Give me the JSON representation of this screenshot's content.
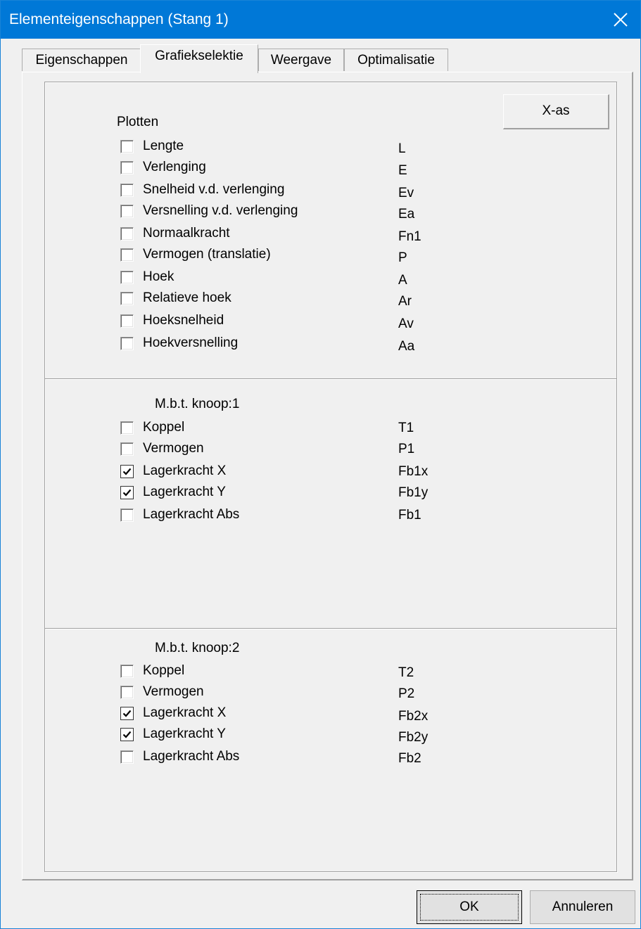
{
  "window": {
    "title": "Elementeigenschappen (Stang 1)"
  },
  "tabs": [
    {
      "label": "Eigenschappen",
      "active": false
    },
    {
      "label": "Grafiekselektie",
      "active": true
    },
    {
      "label": "Weergave",
      "active": false
    },
    {
      "label": "Optimalisatie",
      "active": false
    }
  ],
  "xas_button": {
    "label": "X-as"
  },
  "plotten": {
    "heading": "Plotten",
    "items": [
      {
        "label": "Lengte",
        "code": "L",
        "checked": false
      },
      {
        "label": "Verlenging",
        "code": "E",
        "checked": false
      },
      {
        "label": "Snelheid v.d. verlenging",
        "code": "Ev",
        "checked": false
      },
      {
        "label": "Versnelling v.d. verlenging",
        "code": "Ea",
        "checked": false
      },
      {
        "label": "Normaalkracht",
        "code": "Fn1",
        "checked": false
      },
      {
        "label": "Vermogen (translatie)",
        "code": "P",
        "checked": false
      },
      {
        "label": "Hoek",
        "code": "A",
        "checked": false
      },
      {
        "label": "Relatieve hoek",
        "code": "Ar",
        "checked": false
      },
      {
        "label": "Hoeksnelheid",
        "code": "Av",
        "checked": false
      },
      {
        "label": "Hoekversnelling",
        "code": "Aa",
        "checked": false
      }
    ]
  },
  "knoop1": {
    "heading": "M.b.t. knoop:1",
    "items": [
      {
        "label": "Koppel",
        "code": "T1",
        "checked": false
      },
      {
        "label": "Vermogen",
        "code": "P1",
        "checked": false
      },
      {
        "label": "Lagerkracht X",
        "code": "Fb1x",
        "checked": true
      },
      {
        "label": "Lagerkracht Y",
        "code": "Fb1y",
        "checked": true
      },
      {
        "label": "Lagerkracht Abs",
        "code": "Fb1",
        "checked": false
      }
    ]
  },
  "knoop2": {
    "heading": "M.b.t. knoop:2",
    "items": [
      {
        "label": "Koppel",
        "code": "T2",
        "checked": false
      },
      {
        "label": "Vermogen",
        "code": "P2",
        "checked": false
      },
      {
        "label": "Lagerkracht X",
        "code": "Fb2x",
        "checked": true
      },
      {
        "label": "Lagerkracht Y",
        "code": "Fb2y",
        "checked": true
      },
      {
        "label": "Lagerkracht Abs",
        "code": "Fb2",
        "checked": false
      }
    ]
  },
  "footer": {
    "ok_label": "OK",
    "cancel_label": "Annuleren"
  },
  "colors": {
    "titlebar": "#0078d7",
    "background": "#f0f0f0"
  }
}
